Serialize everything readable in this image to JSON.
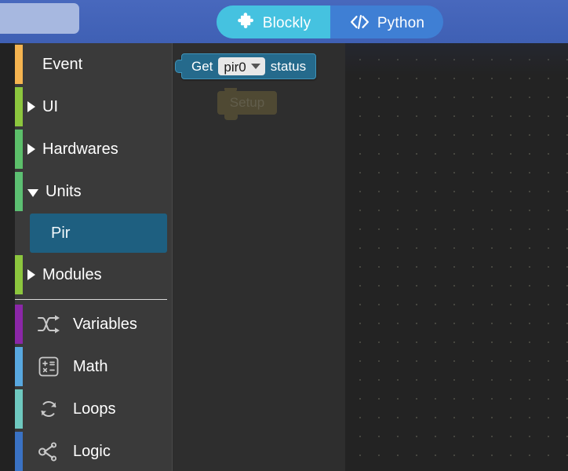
{
  "topbar": {
    "placeholder_label": "",
    "mode_toggle": {
      "blockly": {
        "label": "Blockly",
        "icon": "puzzle-piece-icon",
        "active": true
      },
      "python": {
        "label": "Python",
        "icon": "code-brackets-icon",
        "active": false
      }
    },
    "background_color": "#4061b5",
    "active_tab_color": "#45c2e0"
  },
  "toolbox": {
    "categories": [
      {
        "label": "Event",
        "color": "#f5b450",
        "state": "leaf",
        "icon": ""
      },
      {
        "label": "UI",
        "color": "#8cc63e",
        "state": "collapsed",
        "icon": ""
      },
      {
        "label": "Hardwares",
        "color": "#5cbf6a",
        "state": "collapsed",
        "icon": ""
      },
      {
        "label": "Units",
        "color": "#5cbf72",
        "state": "expanded",
        "icon": ""
      },
      {
        "label": "Modules",
        "color": "#8cc63e",
        "state": "collapsed",
        "icon": ""
      }
    ],
    "subcategories": [
      {
        "label": "Pir",
        "parent": "Units",
        "selected": true,
        "highlight_color": "#1e5f80"
      }
    ],
    "builtin": [
      {
        "label": "Variables",
        "color": "#8b27a8",
        "icon": "shuffle-arrows-icon"
      },
      {
        "label": "Math",
        "color": "#58a8e0",
        "icon": "calculator-icon"
      },
      {
        "label": "Loops",
        "color": "#6ec8bf",
        "icon": "loop-arrows-icon"
      },
      {
        "label": "Logic",
        "color": "#3a72c4",
        "icon": "node-branch-icon"
      }
    ]
  },
  "flyout": {
    "blocks": [
      {
        "type": "reporter",
        "color": "#256a8c",
        "prefix": "Get",
        "suffix": "status",
        "dropdown_value": "pir0",
        "dropdown_options": [
          "pir0"
        ]
      }
    ]
  },
  "workspace": {
    "ghost_block": {
      "label": "Setup",
      "color": "#6b6038"
    },
    "grid_spacing_px": 24,
    "background_color": "#232323"
  }
}
